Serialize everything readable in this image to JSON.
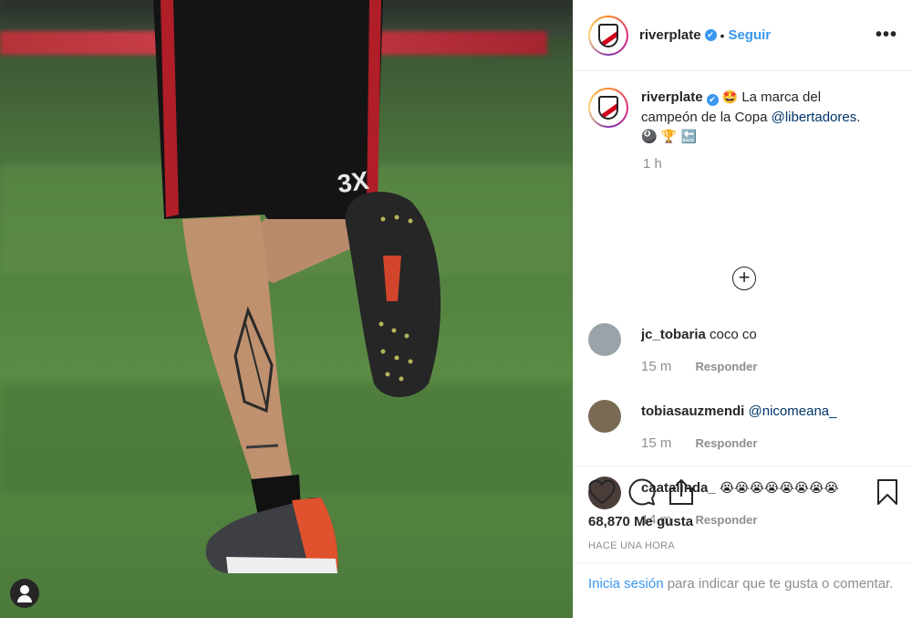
{
  "post": {
    "username": "riverplate",
    "verified_mark": "✔",
    "separator": "•",
    "follow_label": "Seguir",
    "more_label": "•••"
  },
  "caption": {
    "username": "riverplate",
    "emoji_start": "🤩",
    "text_1": "La marca del campeón de la Copa",
    "mention": "@libertadores",
    "text_2": ".",
    "emoji_end": "🎱 🏆 🔙",
    "time": "1 h",
    "plus_label": "+"
  },
  "comments": [
    {
      "username": "jc_tobaria",
      "text": "coco co",
      "time": "15 m",
      "reply_label": "Responder",
      "avatar_color": "#9aa3a8"
    },
    {
      "username": "tobiasauzmendi",
      "text": "@nicomeana_",
      "time": "15 m",
      "reply_label": "Responder",
      "avatar_color": "#7a6a54"
    },
    {
      "username": "caatalinda_",
      "text": "😭😭😭😭😭😭😭😭",
      "time": "14 m",
      "reply_label": "Responder",
      "avatar_color": "#4a3d3a"
    }
  ],
  "actions": {
    "like_icon": "heart-icon",
    "comment_icon": "comment-icon",
    "share_icon": "share-icon",
    "save_icon": "bookmark-icon",
    "likes_count": "68,870",
    "likes_label": "Me gusta",
    "timestamp": "HACE UNA HORA"
  },
  "login": {
    "link_text": "Inicia sesión",
    "rest_text": "para indicar que te gusta o comentar."
  },
  "colors": {
    "accent": "#3897f0",
    "muted": "#8e8e8e",
    "text": "#262626"
  }
}
